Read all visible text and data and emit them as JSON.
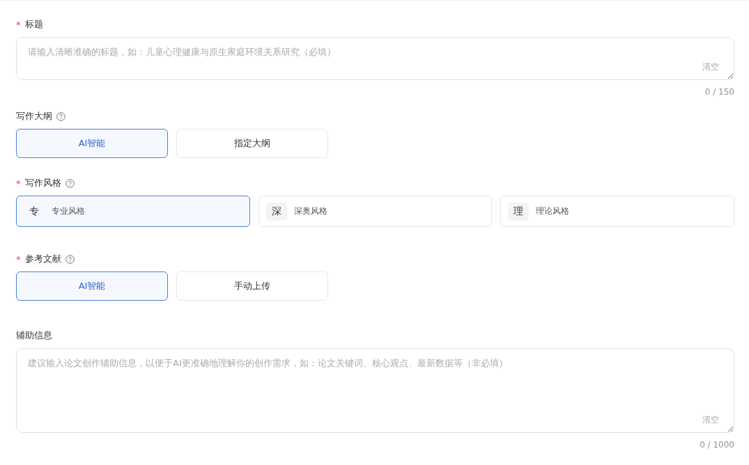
{
  "sections": [
    {
      "kind": "text",
      "label": "标题",
      "required_mark": "*",
      "help": false,
      "placeholder": "请输入清晰准确的标题，如：儿童心理健康与原生家庭环境关系研究（必填）",
      "clear": "清空",
      "counter": "0 / 150",
      "tall": false
    },
    {
      "kind": "choice",
      "label": "写作大纲",
      "help": true,
      "options": [
        {
          "label": "AI智能",
          "selected": true
        },
        {
          "label": "指定大纲",
          "selected": false
        }
      ]
    },
    {
      "kind": "card",
      "label": "写作风格",
      "required_mark": "*",
      "help": true,
      "options": [
        {
          "badge": "专",
          "label": "专业风格",
          "selected": true
        },
        {
          "badge": "深",
          "label": "深奥风格",
          "selected": false
        },
        {
          "badge": "理",
          "label": "理论风格",
          "selected": false
        }
      ]
    },
    {
      "kind": "choice",
      "label": "参考文献",
      "required_mark": "*",
      "help": true,
      "options": [
        {
          "label": "AI智能",
          "selected": true
        },
        {
          "label": "手动上传",
          "selected": false
        }
      ]
    },
    {
      "kind": "text",
      "label": "辅助信息",
      "help": false,
      "placeholder": "建议输入论文创作辅助信息，以便于AI更准确地理解你的创作需求，如：论文关键词、核心观点、最新数据等（非必填）",
      "clear": "清空",
      "counter": "0 / 1000",
      "tall": true
    }
  ]
}
